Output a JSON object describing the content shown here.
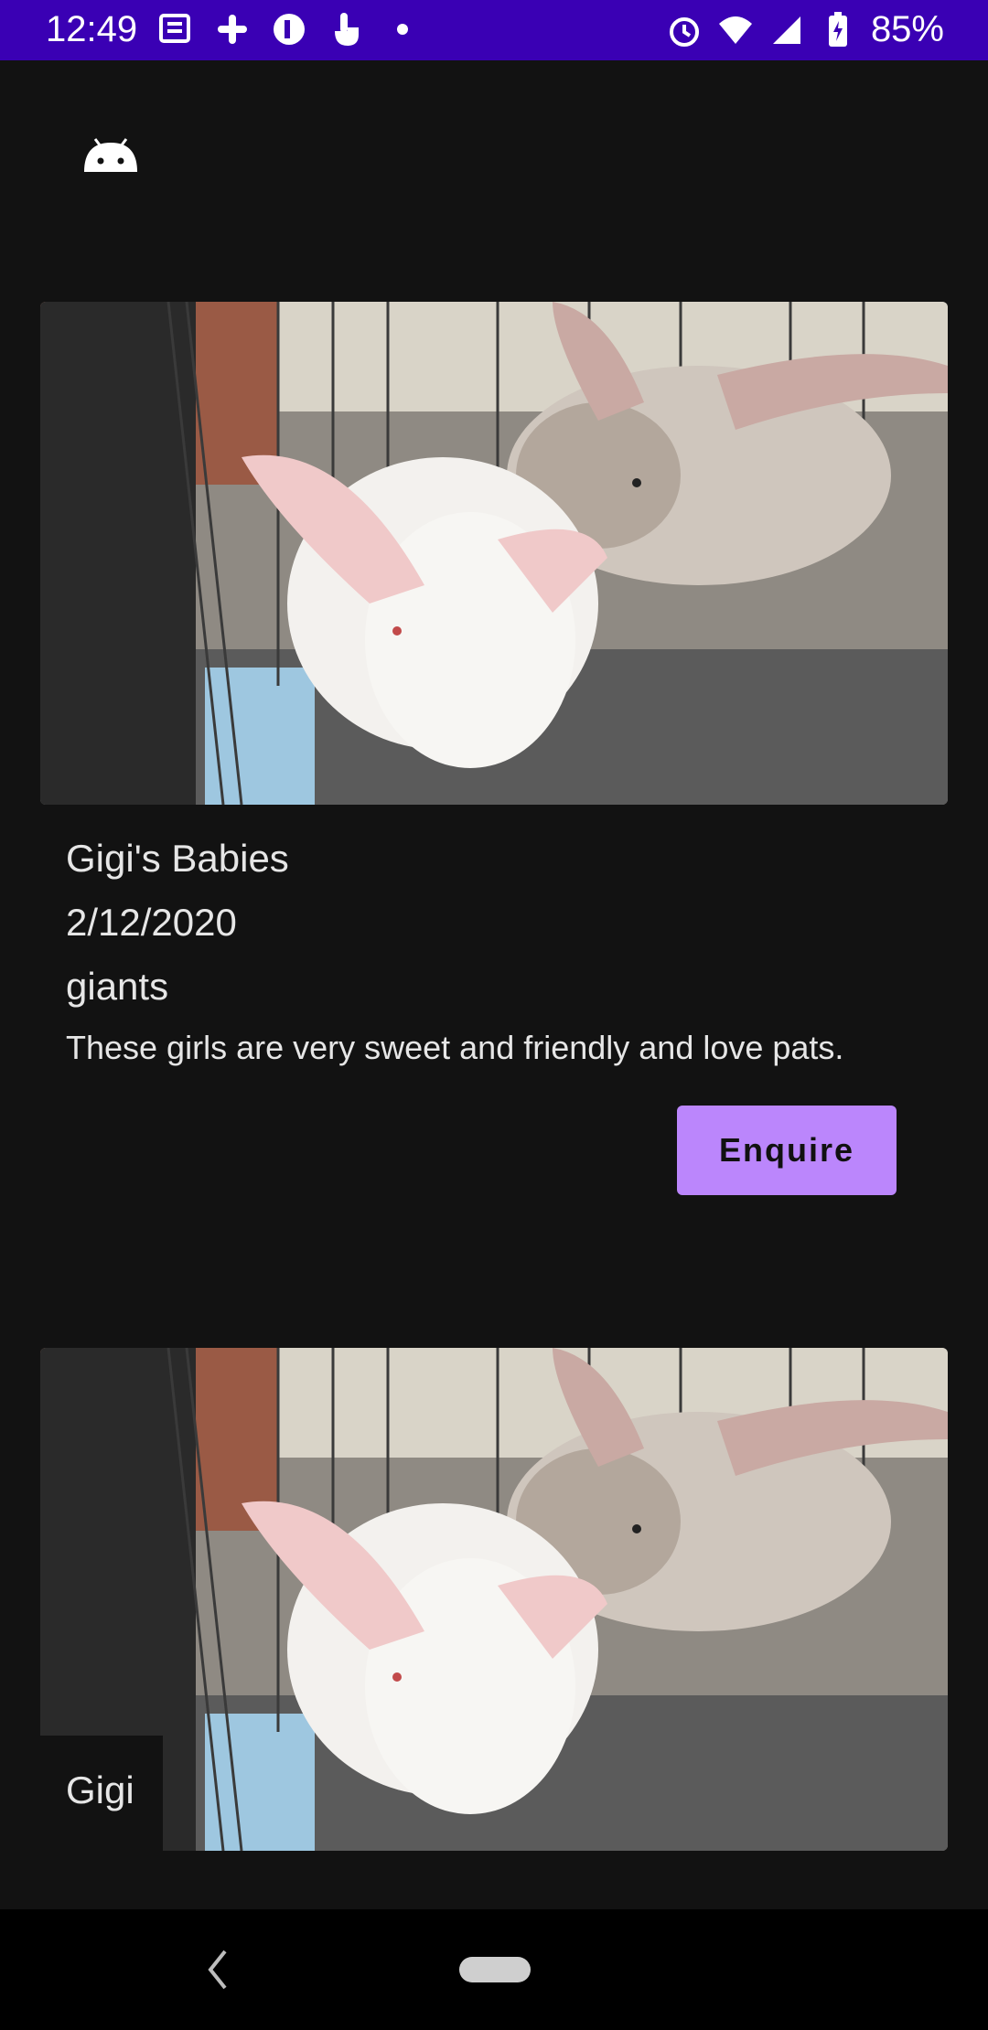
{
  "status_bar": {
    "time": "12:49",
    "left_icons": [
      "news-icon",
      "slack-icon",
      "app-icon",
      "touch-icon",
      "dot-icon"
    ],
    "right_icons": [
      "alarm-icon",
      "wifi-icon",
      "signal-icon",
      "battery-icon"
    ],
    "battery_text": "85%"
  },
  "app": {
    "icon": "android-icon"
  },
  "listings": [
    {
      "image_alt": "Two white rabbits in a cage",
      "title": "Gigi's Babies",
      "date": "2/12/2020",
      "breed": "giants",
      "description": "These girls are very sweet and friendly and love pats.",
      "button_label": "Enquire"
    },
    {
      "image_alt": "Two white rabbits in a cage",
      "title": "Gigi"
    }
  ],
  "nav_bar": {
    "back_icon": "back-icon",
    "home_icon": "home-pill-icon"
  }
}
